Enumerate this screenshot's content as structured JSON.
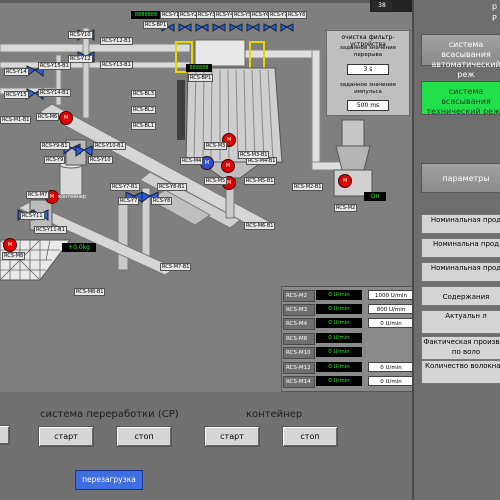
{
  "top": {
    "counter_left": "38",
    "edge_letter_top": "р",
    "edge_letter_right": "Р"
  },
  "valves_top": [
    "RCS-Y1",
    "RCS-Y2",
    "RCS-Y3",
    "RCS-Y4",
    "RCS-Y5",
    "RCS-Y6",
    "RCS-Y7",
    "RCS-Y8"
  ],
  "bp1_top": "RCS-BP1",
  "bp1_mid": "RCS-BP1",
  "left_valves": {
    "y10": "RCS-Y10",
    "y12b1": "RCS-Y12-B1",
    "y12": "RCS-Y12",
    "y13b1": "RCS-Y13-B1",
    "y14": "RCS-Y14",
    "y15b1": "RCS-Y15-B1",
    "y15": "RCS-Y15",
    "y14b1": "RCS-Y14-B1",
    "m1b1": "RCS-M1-B1"
  },
  "levels": [
    "RCS-BL3",
    "RCS-BL2",
    "RCS-BL1"
  ],
  "mid_tags": {
    "m6": "RCS-M6",
    "y9b1": "RCS-Y9-B1",
    "y10b1": "RCS-Y10-B1",
    "y9": "RCS-Y9",
    "y10": "RCS-Y10",
    "container": "контейнер",
    "m7": "RCS-M7",
    "y7b1": "RCS-Y7-B1",
    "y8b1": "RCS-Y8-B1",
    "y7": "RCS-Y7",
    "y8": "RCS-Y8",
    "m4": "RCS-M4",
    "m4b1": "RCS-M4-B1",
    "m5": "RCS-M5",
    "m5b1": "RCS-M5-B1",
    "m3": "RCS-M3",
    "m3b1": "RCS-M3-B1",
    "m2b1": "RCS-M2-B1",
    "m2": "RCS-M2",
    "m6b1": "RCS-M6-B1",
    "m7b1": "RCS-M7-B1",
    "m8": "RCS-M8",
    "m8b1": "RCS-M8-B1",
    "y11": "RCS-Y11",
    "y11b1": "RCS-Y11-B1",
    "weight": "+0,0kg",
    "on": "On"
  },
  "filter": {
    "title": "очистка фильтр-устройства",
    "pause_label": "заданное значение перерыва",
    "pause_value": "3 s",
    "pulse_label": "заданное значение импульса",
    "pulse_value": "500 ms"
  },
  "motor_table": [
    {
      "name": "RCS-M2",
      "actual": "0 U/min",
      "set": "1000 U/min"
    },
    {
      "name": "RCS-M3",
      "actual": "0 U/min",
      "set": "800 U/min"
    },
    {
      "name": "RCS-M4",
      "actual": "0 U/min",
      "set": "0 U/min"
    },
    {
      "name": "RCS-M8",
      "actual": "0 U/min",
      "set": ""
    },
    {
      "name": "RCS-M10",
      "actual": "0 U/min",
      "set": ""
    },
    {
      "name": "RCS-M12",
      "actual": "0 U/min",
      "set": "0 U/min"
    },
    {
      "name": "RCS-M14",
      "actual": "0 U/min",
      "set": "0 U/min"
    }
  ],
  "bottom": {
    "cp_title": "система переработки (CP)",
    "container_title": "контейнер",
    "start1": "старт",
    "stop1": "стоп",
    "start2": "старт",
    "stop2": "стоп",
    "reload": "перезагрузка"
  },
  "right_panel": {
    "auto_mode": "система всасывания автоматический реж",
    "tech_mode": "система всасывания технический режи",
    "params": "параметры",
    "list": [
      "Номинальная прод",
      "Номинальна прод",
      "Номинальная прод",
      "Содержания",
      "Актуальн л",
      "Фактическая производ по воло",
      "Количество волокна в"
    ]
  },
  "colors": {
    "background": "#7f7f7f",
    "motor_red": "#e00000",
    "motor_blue": "#2a4fd6",
    "active_green": "#22e04a"
  }
}
